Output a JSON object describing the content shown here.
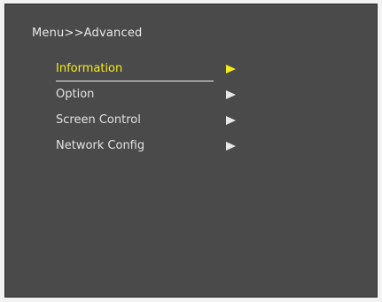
{
  "breadcrumb": "Menu>>Advanced",
  "menu": {
    "items": [
      {
        "label": "Information",
        "selected": true
      },
      {
        "label": "Option",
        "selected": false
      },
      {
        "label": "Screen Control",
        "selected": false
      },
      {
        "label": "Network Config",
        "selected": false
      }
    ]
  },
  "colors": {
    "panel_background": "#4a4a4a",
    "text": "#e2e2e2",
    "selected_highlight": "#f2ea1c"
  },
  "icons": {
    "submenu_arrow": "triangle-right-icon"
  }
}
